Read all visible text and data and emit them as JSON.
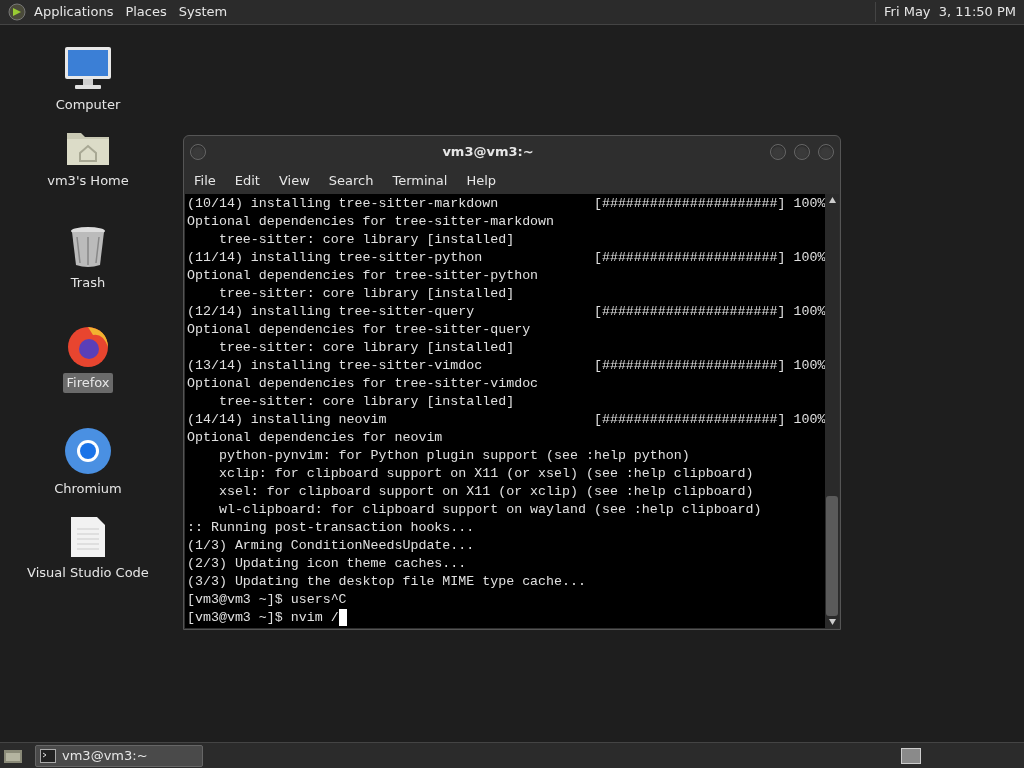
{
  "top_panel": {
    "menus": [
      "Applications",
      "Places",
      "System"
    ],
    "clock": "Fri May  3, 11:50 PM"
  },
  "desktop_icons": [
    {
      "kind": "computer",
      "label": "Computer",
      "selected": false
    },
    {
      "kind": "home",
      "label": "vm3's Home",
      "selected": false
    },
    {
      "kind": "trash",
      "label": "Trash",
      "selected": false
    },
    {
      "kind": "firefox",
      "label": "Firefox",
      "selected": true
    },
    {
      "kind": "chromium",
      "label": "Chromium",
      "selected": false
    },
    {
      "kind": "file",
      "label": "Visual Studio Code",
      "selected": false
    }
  ],
  "terminal": {
    "title": "vm3@vm3:~",
    "menu": [
      "File",
      "Edit",
      "View",
      "Search",
      "Terminal",
      "Help"
    ],
    "lines": [
      "(10/14) installing tree-sitter-markdown            [######################] 100%",
      "Optional dependencies for tree-sitter-markdown",
      "    tree-sitter: core library [installed]",
      "(11/14) installing tree-sitter-python              [######################] 100%",
      "Optional dependencies for tree-sitter-python",
      "    tree-sitter: core library [installed]",
      "(12/14) installing tree-sitter-query               [######################] 100%",
      "Optional dependencies for tree-sitter-query",
      "    tree-sitter: core library [installed]",
      "(13/14) installing tree-sitter-vimdoc              [######################] 100%",
      "Optional dependencies for tree-sitter-vimdoc",
      "    tree-sitter: core library [installed]",
      "(14/14) installing neovim                          [######################] 100%",
      "Optional dependencies for neovim",
      "    python-pynvim: for Python plugin support (see :help python)",
      "    xclip: for clipboard support on X11 (or xsel) (see :help clipboard)",
      "    xsel: for clipboard support on X11 (or xclip) (see :help clipboard)",
      "    wl-clipboard: for clipboard support on wayland (see :help clipboard)",
      ":: Running post-transaction hooks...",
      "(1/3) Arming ConditionNeedsUpdate...",
      "(2/3) Updating icon theme caches...",
      "(3/3) Updating the desktop file MIME type cache...",
      "[vm3@vm3 ~]$ users^C",
      "[vm3@vm3 ~]$ nvim /"
    ]
  },
  "taskbar": {
    "tasks": [
      {
        "label": "vm3@vm3:~",
        "selected": true
      }
    ]
  }
}
